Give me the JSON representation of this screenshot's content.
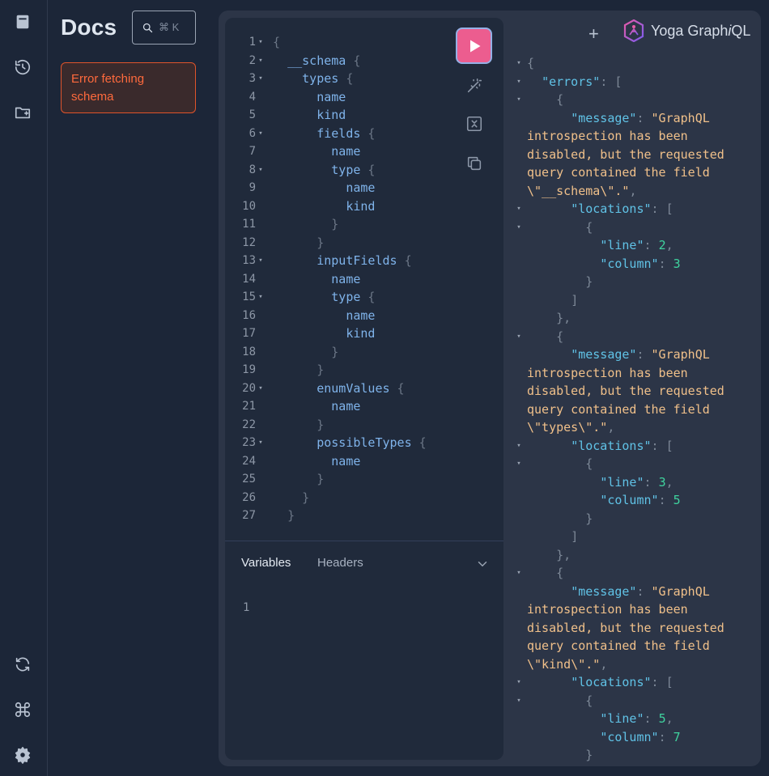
{
  "docs": {
    "title": "Docs",
    "search_shortcut": "⌘ K",
    "error_message": "Error fetching schema"
  },
  "editor": {
    "lines": [
      {
        "n": "1",
        "fold": true,
        "indent": 0,
        "text": "",
        "br": "{"
      },
      {
        "n": "2",
        "fold": true,
        "indent": 1,
        "text": "__schema",
        "br": "{"
      },
      {
        "n": "3",
        "fold": true,
        "indent": 2,
        "text": "types",
        "br": "{"
      },
      {
        "n": "4",
        "fold": false,
        "indent": 3,
        "text": "name",
        "br": ""
      },
      {
        "n": "5",
        "fold": false,
        "indent": 3,
        "text": "kind",
        "br": ""
      },
      {
        "n": "6",
        "fold": true,
        "indent": 3,
        "text": "fields",
        "br": "{"
      },
      {
        "n": "7",
        "fold": false,
        "indent": 4,
        "text": "name",
        "br": ""
      },
      {
        "n": "8",
        "fold": true,
        "indent": 4,
        "text": "type",
        "br": "{"
      },
      {
        "n": "9",
        "fold": false,
        "indent": 5,
        "text": "name",
        "br": ""
      },
      {
        "n": "10",
        "fold": false,
        "indent": 5,
        "text": "kind",
        "br": ""
      },
      {
        "n": "11",
        "fold": false,
        "indent": 4,
        "text": "",
        "br": "}"
      },
      {
        "n": "12",
        "fold": false,
        "indent": 3,
        "text": "",
        "br": "}"
      },
      {
        "n": "13",
        "fold": true,
        "indent": 3,
        "text": "inputFields",
        "br": "{"
      },
      {
        "n": "14",
        "fold": false,
        "indent": 4,
        "text": "name",
        "br": ""
      },
      {
        "n": "15",
        "fold": true,
        "indent": 4,
        "text": "type",
        "br": "{"
      },
      {
        "n": "16",
        "fold": false,
        "indent": 5,
        "text": "name",
        "br": ""
      },
      {
        "n": "17",
        "fold": false,
        "indent": 5,
        "text": "kind",
        "br": ""
      },
      {
        "n": "18",
        "fold": false,
        "indent": 4,
        "text": "",
        "br": "}"
      },
      {
        "n": "19",
        "fold": false,
        "indent": 3,
        "text": "",
        "br": "}"
      },
      {
        "n": "20",
        "fold": true,
        "indent": 3,
        "text": "enumValues",
        "br": "{"
      },
      {
        "n": "21",
        "fold": false,
        "indent": 4,
        "text": "name",
        "br": ""
      },
      {
        "n": "22",
        "fold": false,
        "indent": 3,
        "text": "",
        "br": "}"
      },
      {
        "n": "23",
        "fold": true,
        "indent": 3,
        "text": "possibleTypes",
        "br": "{"
      },
      {
        "n": "24",
        "fold": false,
        "indent": 4,
        "text": "name",
        "br": ""
      },
      {
        "n": "25",
        "fold": false,
        "indent": 3,
        "text": "",
        "br": "}"
      },
      {
        "n": "26",
        "fold": false,
        "indent": 2,
        "text": "",
        "br": "}"
      },
      {
        "n": "27",
        "fold": false,
        "indent": 1,
        "text": "",
        "br": "}"
      }
    ]
  },
  "variables": {
    "tab_variables": "Variables",
    "tab_headers": "Headers",
    "line_number": "1"
  },
  "header": {
    "new_tab": "+",
    "brand_name": "Yoga Graph",
    "brand_italic": "i",
    "brand_suffix": "QL"
  },
  "response": {
    "lines": [
      {
        "fold": true,
        "indent": 0,
        "parts": [
          [
            "p",
            "{"
          ]
        ]
      },
      {
        "fold": true,
        "indent": 1,
        "parts": [
          [
            "k",
            "\"errors\""
          ],
          [
            "p",
            ": ["
          ]
        ]
      },
      {
        "fold": true,
        "indent": 2,
        "parts": [
          [
            "p",
            "{"
          ]
        ]
      },
      {
        "fold": false,
        "indent": 3,
        "parts": [
          [
            "k",
            "\"message\""
          ],
          [
            "p",
            ": "
          ],
          [
            "s",
            "\"GraphQL"
          ]
        ]
      },
      {
        "fold": false,
        "indent": 0,
        "parts": [
          [
            "s",
            "introspection has been"
          ]
        ]
      },
      {
        "fold": false,
        "indent": 0,
        "parts": [
          [
            "s",
            "disabled, but the requested"
          ]
        ]
      },
      {
        "fold": false,
        "indent": 0,
        "parts": [
          [
            "s",
            "query contained the field"
          ]
        ]
      },
      {
        "fold": false,
        "indent": 0,
        "parts": [
          [
            "s",
            "\\\"__schema\\\".\""
          ],
          [
            "p",
            ","
          ]
        ]
      },
      {
        "fold": true,
        "indent": 3,
        "parts": [
          [
            "k",
            "\"locations\""
          ],
          [
            "p",
            ": ["
          ]
        ]
      },
      {
        "fold": true,
        "indent": 4,
        "parts": [
          [
            "p",
            "{"
          ]
        ]
      },
      {
        "fold": false,
        "indent": 5,
        "parts": [
          [
            "k",
            "\"line\""
          ],
          [
            "p",
            ": "
          ],
          [
            "n",
            "2"
          ],
          [
            "p",
            ","
          ]
        ]
      },
      {
        "fold": false,
        "indent": 5,
        "parts": [
          [
            "k",
            "\"column\""
          ],
          [
            "p",
            ": "
          ],
          [
            "n",
            "3"
          ]
        ]
      },
      {
        "fold": false,
        "indent": 4,
        "parts": [
          [
            "p",
            "}"
          ]
        ]
      },
      {
        "fold": false,
        "indent": 3,
        "parts": [
          [
            "p",
            "]"
          ]
        ]
      },
      {
        "fold": false,
        "indent": 2,
        "parts": [
          [
            "p",
            "},"
          ]
        ]
      },
      {
        "fold": true,
        "indent": 2,
        "parts": [
          [
            "p",
            "{"
          ]
        ]
      },
      {
        "fold": false,
        "indent": 3,
        "parts": [
          [
            "k",
            "\"message\""
          ],
          [
            "p",
            ": "
          ],
          [
            "s",
            "\"GraphQL"
          ]
        ]
      },
      {
        "fold": false,
        "indent": 0,
        "parts": [
          [
            "s",
            "introspection has been"
          ]
        ]
      },
      {
        "fold": false,
        "indent": 0,
        "parts": [
          [
            "s",
            "disabled, but the requested"
          ]
        ]
      },
      {
        "fold": false,
        "indent": 0,
        "parts": [
          [
            "s",
            "query contained the field"
          ]
        ]
      },
      {
        "fold": false,
        "indent": 0,
        "parts": [
          [
            "s",
            "\\\"types\\\".\""
          ],
          [
            "p",
            ","
          ]
        ]
      },
      {
        "fold": true,
        "indent": 3,
        "parts": [
          [
            "k",
            "\"locations\""
          ],
          [
            "p",
            ": ["
          ]
        ]
      },
      {
        "fold": true,
        "indent": 4,
        "parts": [
          [
            "p",
            "{"
          ]
        ]
      },
      {
        "fold": false,
        "indent": 5,
        "parts": [
          [
            "k",
            "\"line\""
          ],
          [
            "p",
            ": "
          ],
          [
            "n",
            "3"
          ],
          [
            "p",
            ","
          ]
        ]
      },
      {
        "fold": false,
        "indent": 5,
        "parts": [
          [
            "k",
            "\"column\""
          ],
          [
            "p",
            ": "
          ],
          [
            "n",
            "5"
          ]
        ]
      },
      {
        "fold": false,
        "indent": 4,
        "parts": [
          [
            "p",
            "}"
          ]
        ]
      },
      {
        "fold": false,
        "indent": 3,
        "parts": [
          [
            "p",
            "]"
          ]
        ]
      },
      {
        "fold": false,
        "indent": 2,
        "parts": [
          [
            "p",
            "},"
          ]
        ]
      },
      {
        "fold": true,
        "indent": 2,
        "parts": [
          [
            "p",
            "{"
          ]
        ]
      },
      {
        "fold": false,
        "indent": 3,
        "parts": [
          [
            "k",
            "\"message\""
          ],
          [
            "p",
            ": "
          ],
          [
            "s",
            "\"GraphQL"
          ]
        ]
      },
      {
        "fold": false,
        "indent": 0,
        "parts": [
          [
            "s",
            "introspection has been"
          ]
        ]
      },
      {
        "fold": false,
        "indent": 0,
        "parts": [
          [
            "s",
            "disabled, but the requested"
          ]
        ]
      },
      {
        "fold": false,
        "indent": 0,
        "parts": [
          [
            "s",
            "query contained the field"
          ]
        ]
      },
      {
        "fold": false,
        "indent": 0,
        "parts": [
          [
            "s",
            "\\\"kind\\\".\""
          ],
          [
            "p",
            ","
          ]
        ]
      },
      {
        "fold": true,
        "indent": 3,
        "parts": [
          [
            "k",
            "\"locations\""
          ],
          [
            "p",
            ": ["
          ]
        ]
      },
      {
        "fold": true,
        "indent": 4,
        "parts": [
          [
            "p",
            "{"
          ]
        ]
      },
      {
        "fold": false,
        "indent": 5,
        "parts": [
          [
            "k",
            "\"line\""
          ],
          [
            "p",
            ": "
          ],
          [
            "n",
            "5"
          ],
          [
            "p",
            ","
          ]
        ]
      },
      {
        "fold": false,
        "indent": 5,
        "parts": [
          [
            "k",
            "\"column\""
          ],
          [
            "p",
            ": "
          ],
          [
            "n",
            "7"
          ]
        ]
      },
      {
        "fold": false,
        "indent": 4,
        "parts": [
          [
            "p",
            "}"
          ]
        ]
      }
    ]
  },
  "colors": {
    "run_button": "#ec5d8f",
    "error_text": "#ff6a3d",
    "json_key": "#60c2e6",
    "json_string": "#f0c08a",
    "json_number": "#3fd39e"
  }
}
